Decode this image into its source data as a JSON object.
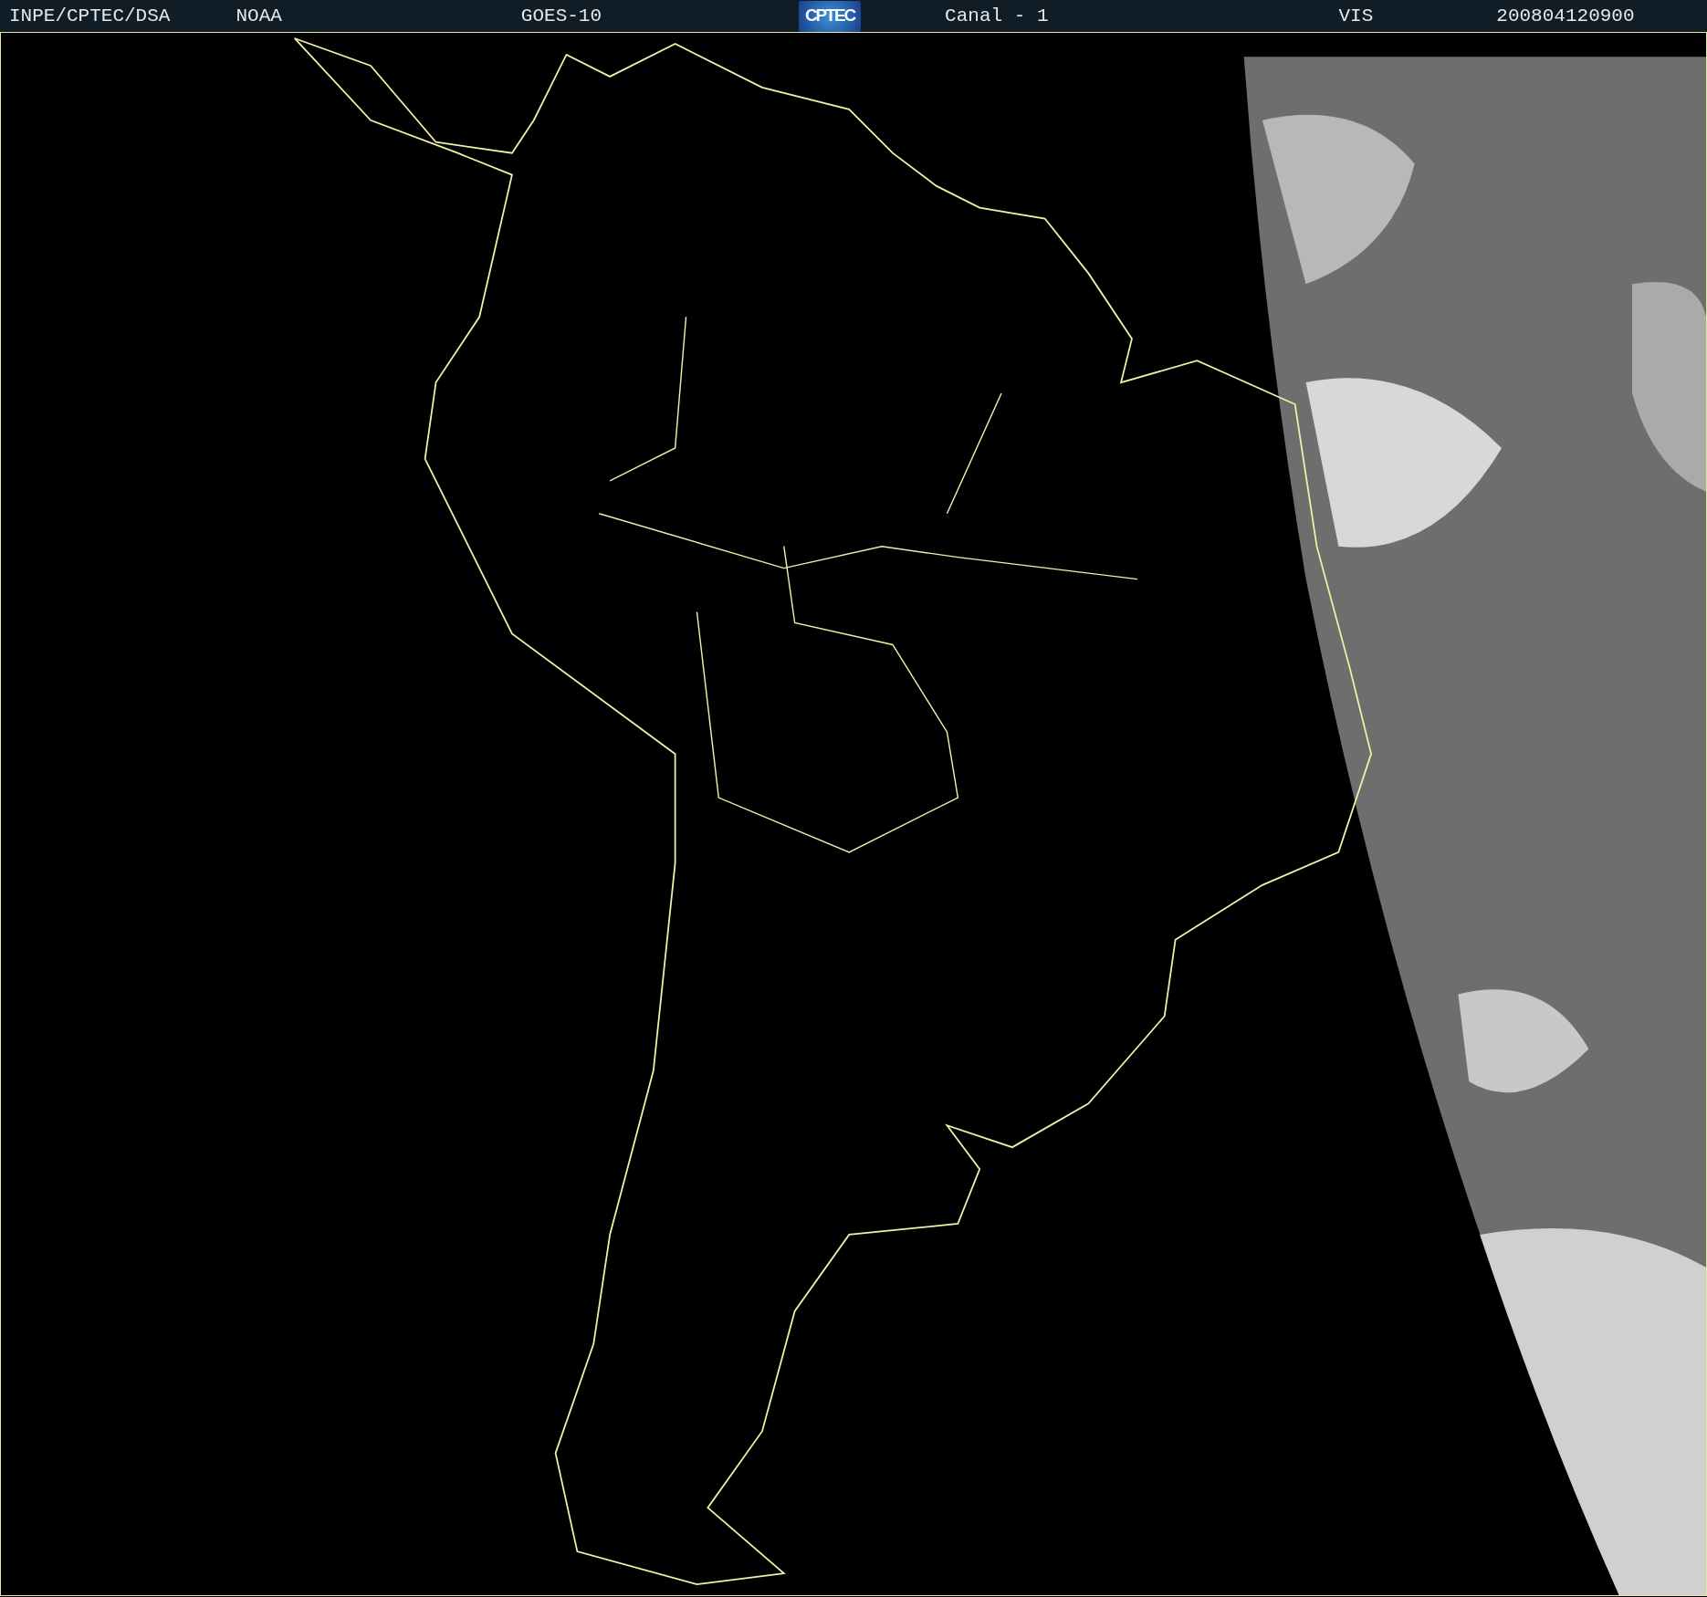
{
  "header": {
    "items": [
      {
        "kind": "text",
        "text": "INPE/CPTEC/DSA"
      },
      {
        "kind": "text",
        "text": "NOAA"
      },
      {
        "kind": "text",
        "text": "GOES-10"
      },
      {
        "kind": "logo",
        "text": "CPTEC"
      },
      {
        "kind": "text",
        "text": "Canal - 1"
      },
      {
        "kind": "text",
        "text": "VIS"
      },
      {
        "kind": "text",
        "text": "200804120900"
      }
    ]
  }
}
